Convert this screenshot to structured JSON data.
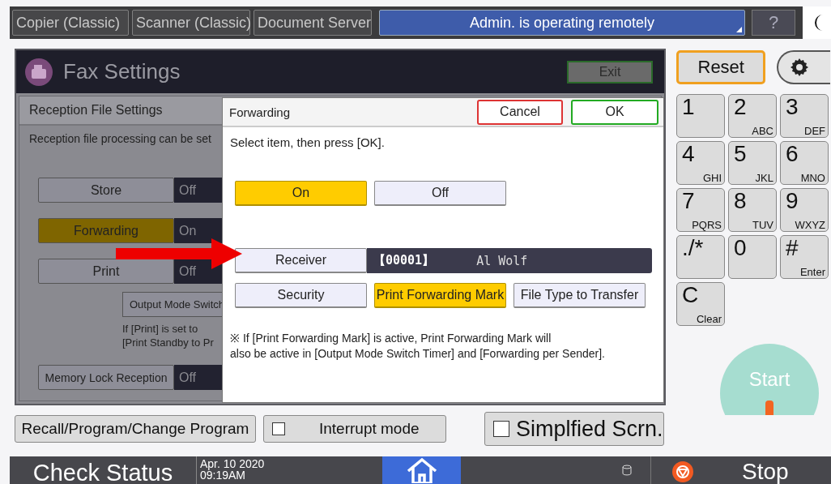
{
  "top_bar": {
    "tabs": [
      {
        "label": "Copier (Classic)",
        "selected": false
      },
      {
        "label": "Scanner (Classic)",
        "selected": false
      },
      {
        "label": "Document Server",
        "selected": false
      }
    ],
    "notice": "Admin. is operating remotely",
    "help": "?"
  },
  "panel": {
    "title": "Fax Settings",
    "exit": "Exit",
    "section": "Reception File Settings",
    "description": "Reception file processing can be set",
    "settings": [
      {
        "label": "Store",
        "value": "Off",
        "selected": false
      },
      {
        "label": "Forwarding",
        "value": "On",
        "selected": true
      },
      {
        "label": "Print",
        "value": "Off",
        "selected": false
      }
    ],
    "output_mode": "Output Mode Switch",
    "note_lines": [
      "If [Print] is set to",
      "[Print Standby to Pr"
    ],
    "memory_lock": {
      "label": "Memory Lock Reception",
      "value": "Off"
    }
  },
  "dialog": {
    "title": "Forwarding",
    "cancel": "Cancel",
    "ok": "OK",
    "instruction": "Select item, then press [OK].",
    "options": [
      {
        "label": "On",
        "selected": true
      },
      {
        "label": "Off",
        "selected": false
      }
    ],
    "receiver": {
      "label": "Receiver",
      "number": "【00001】",
      "name": "Al Wolf"
    },
    "buttons": [
      {
        "label": "Security",
        "selected": false
      },
      {
        "label": "Print Forwarding Mark",
        "selected": true
      },
      {
        "label": "File Type to Transfer",
        "selected": false
      }
    ],
    "note_lines": [
      "※ If [Print Forwarding Mark] is active, Print Forwarding Mark will",
      "also be active in [Output Mode Switch Timer] and [Forwarding per Sender]."
    ]
  },
  "keypad": {
    "reset": "Reset",
    "keys": [
      {
        "main": "1"
      },
      {
        "main": "2",
        "sub": "ABC"
      },
      {
        "main": "3",
        "sub": "DEF"
      },
      {
        "main": "4",
        "sub": "GHI"
      },
      {
        "main": "5",
        "sub": "JKL"
      },
      {
        "main": "6",
        "sub": "MNO"
      },
      {
        "main": "7",
        "sub": "PQRS"
      },
      {
        "main": "8",
        "sub": "TUV"
      },
      {
        "main": "9",
        "sub": "WXYZ"
      },
      {
        "main": "./*"
      },
      {
        "main": "0"
      },
      {
        "main": "#",
        "sub": "Enter"
      },
      {
        "main": "C",
        "sub": "Clear"
      }
    ],
    "start": "Start"
  },
  "bottom": {
    "recall": "Recall/Program/Change Program",
    "interrupt": {
      "label": "Interrupt mode",
      "checked": false
    },
    "simplified": {
      "label": "Simplfied Scrn.",
      "checked": false
    }
  },
  "status_bar": {
    "check_status": "Check Status",
    "date": "Apr. 10 2020",
    "time": "09:19AM",
    "stop": "Stop"
  }
}
